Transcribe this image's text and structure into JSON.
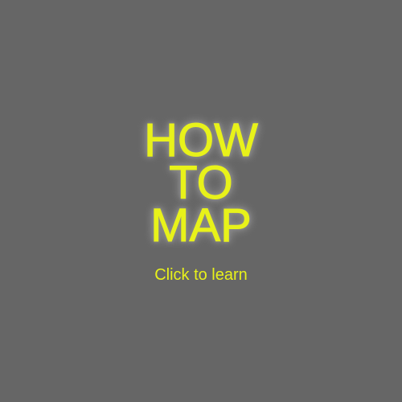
{
  "title": {
    "lines": [
      "HOW",
      "TO",
      "MAP"
    ]
  },
  "cta": {
    "label": "Click to learn"
  },
  "colors": {
    "background": "#666666",
    "text": "#e8f21a",
    "glow": "#8a8a8a"
  }
}
